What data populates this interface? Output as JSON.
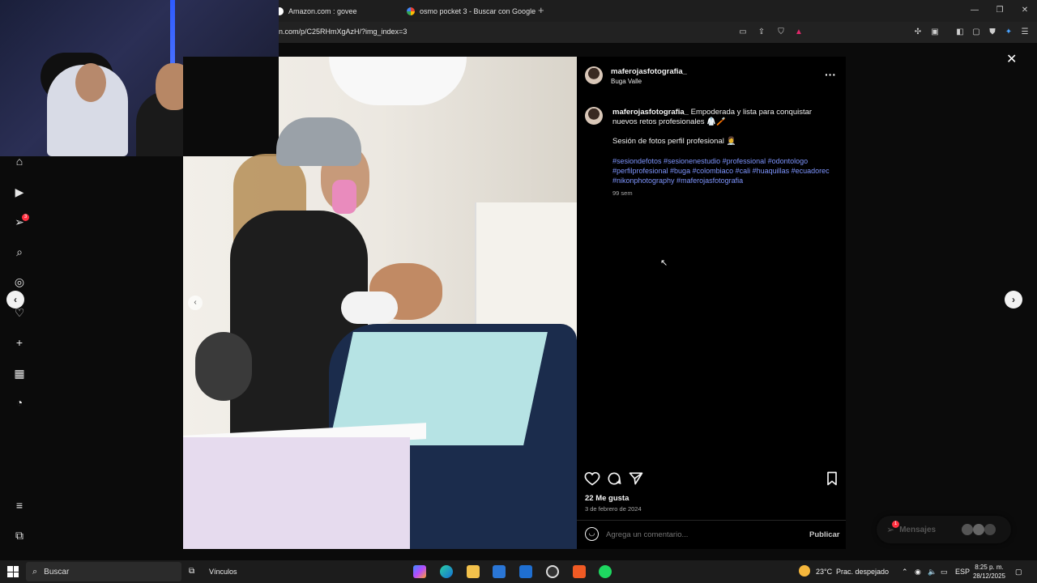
{
  "browser": {
    "tabs": [
      {
        "title": "Amazon.com : govee"
      },
      {
        "title": "osmo pocket 3 - Buscar con Google"
      }
    ],
    "new_tab_icon": "+",
    "url": "n.com/p/C25RHmXgAzH/?img_index=3"
  },
  "post": {
    "username": "maferojasfotografia_",
    "location": "Buga Valle",
    "caption_text": "Empoderada y lista para conquistar nuevos retos profesionales 🥼🪥",
    "caption_line2": "Sesión de fotos perfil profesional 👩‍⚕️",
    "hashtags_line1": "#sesiondefotos #sesionenestudio #professional #odontologo",
    "hashtags_line2": "#perfilprofesional #buga #colombiaco #cali #huaquillas #ecuadorec",
    "hashtags_line3": "#nikonphotography #maferojasfotografia",
    "age": "99 sem",
    "likes": "22 Me gusta",
    "date": "3 de febrero de 2024",
    "comment_placeholder": "Agrega un comentario...",
    "publish_label": "Publicar",
    "more_icon": "···"
  },
  "sidebar": {
    "notification_count": "3"
  },
  "messages": {
    "label": "Mensajes",
    "badge": "1"
  },
  "taskbar": {
    "search_label": "Buscar",
    "links_label": "Vínculos",
    "weather": "23°C",
    "weather_desc": "Prac. despejado",
    "language": "ESP",
    "time": "8:25 p. m.",
    "date": "28/12/2025"
  },
  "colors": {
    "hashtag": "#7e95ff",
    "modal_panel": "#000000",
    "badge": "#ff3040"
  }
}
